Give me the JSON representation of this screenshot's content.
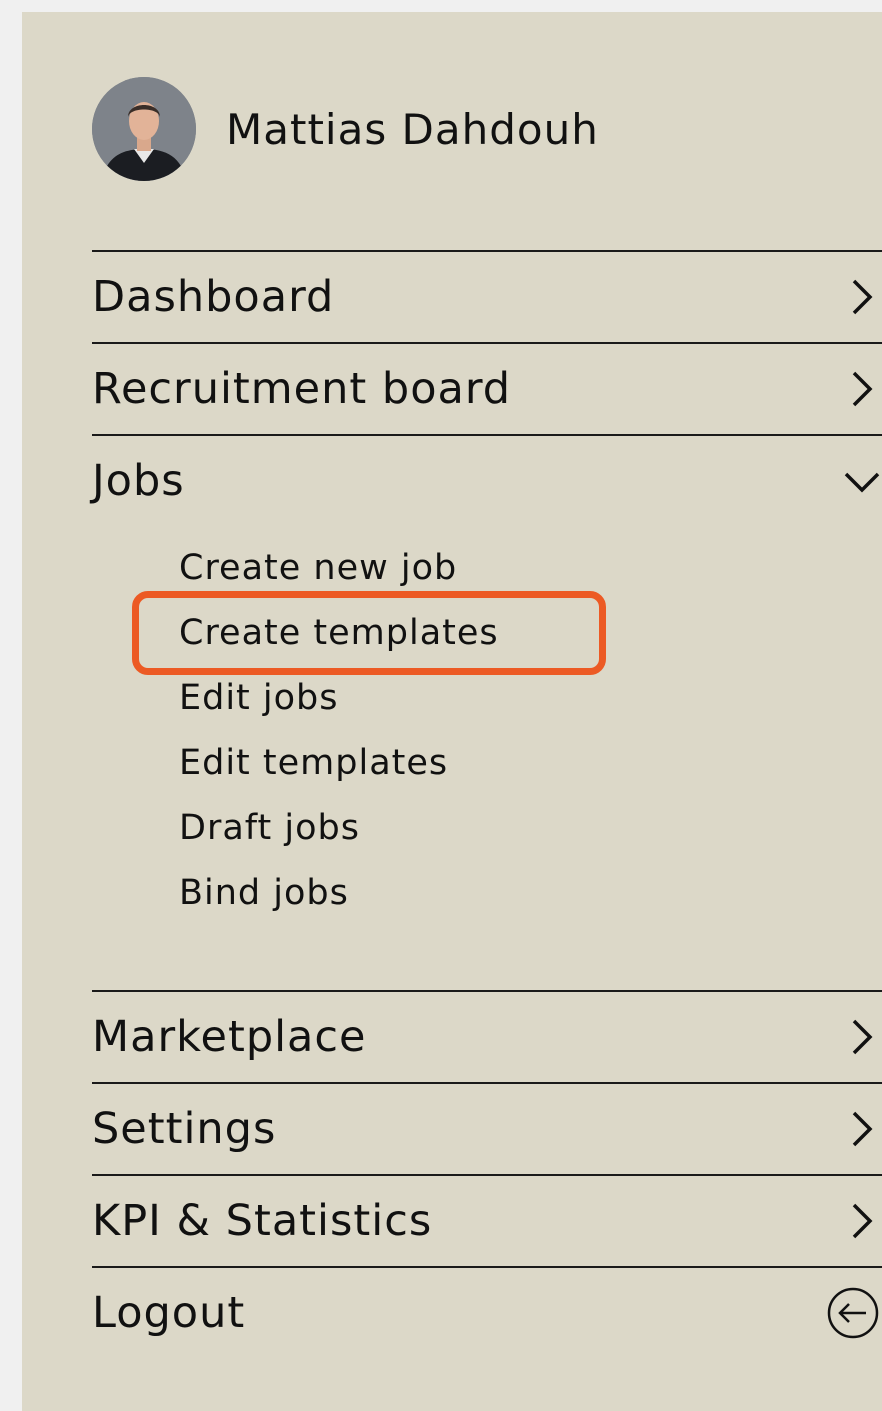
{
  "user": {
    "name": "Mattias Dahdouh",
    "avatar": "user-photo"
  },
  "menu": {
    "dashboard": {
      "label": "Dashboard",
      "icon": "chevron-right-icon"
    },
    "recruitment": {
      "label": "Recruitment board",
      "icon": "chevron-right-icon"
    },
    "jobs": {
      "label": "Jobs",
      "icon": "chevron-down-icon",
      "expanded": true,
      "items": [
        "Create new job",
        "Create templates",
        "Edit jobs",
        "Edit templates",
        "Draft jobs",
        "Bind jobs"
      ],
      "highlighted_item": "Create templates"
    },
    "marketplace": {
      "label": "Marketplace",
      "icon": "chevron-right-icon"
    },
    "settings": {
      "label": "Settings",
      "icon": "chevron-right-icon"
    },
    "kpi": {
      "label": "KPI & Statistics",
      "icon": "chevron-right-icon"
    },
    "logout": {
      "label": "Logout",
      "icon": "logout-arrow-icon"
    }
  },
  "colors": {
    "panel_bg": "#dcd8c8",
    "page_bg": "#f0f0f0",
    "text": "#111111",
    "highlight": "#ec5a24"
  }
}
